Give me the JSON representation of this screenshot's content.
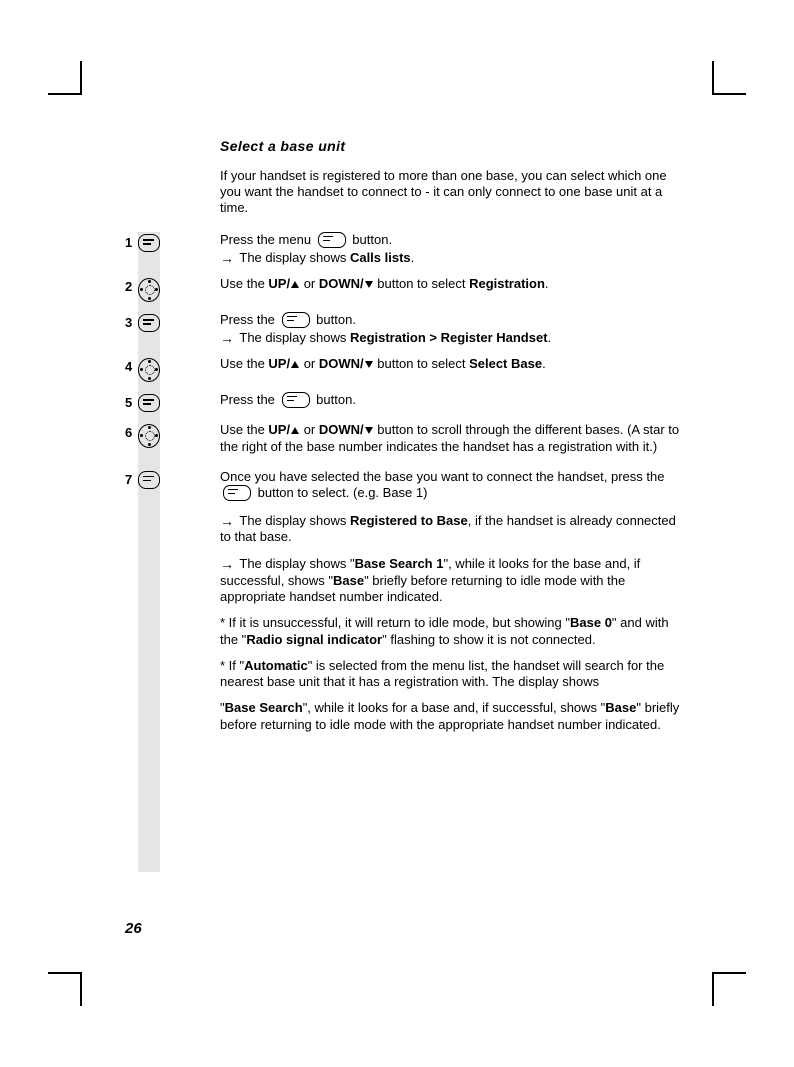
{
  "heading": "Select a base unit",
  "intro": "If your handset is registered to more than one base, you can select which one you want the handset to connect to - it can only connect to one base unit at a time.",
  "steps": {
    "s1": {
      "num": "1",
      "line": "Press the menu",
      "after": " button.",
      "result_pre": "The display shows ",
      "result_b": "Calls lists",
      "result_post": "."
    },
    "s2": {
      "num": "2",
      "pre": "Use the ",
      "up": "UP/",
      "mid": " or ",
      "down": "DOWN/",
      "post": " button to select ",
      "target": "Registration",
      "end": "."
    },
    "s3": {
      "num": "3",
      "line": "Press the",
      "after": " button.",
      "result_pre": "The display shows ",
      "result_b": "Registration > Register Handset",
      "result_post": "."
    },
    "s4": {
      "num": "4",
      "pre": "Use the ",
      "up": "UP/",
      "mid": " or ",
      "down": "DOWN/",
      "post": " button to select ",
      "target": "Select Base",
      "end": "."
    },
    "s5": {
      "num": "5",
      "line": "Press the",
      "after": " button."
    },
    "s6": {
      "num": "6",
      "pre": "Use the ",
      "up": "UP/",
      "mid": " or ",
      "down": "DOWN/",
      "post": " button to scroll through the different bases. (A star to the right of the base number indicates the handset has a registration with it.)"
    },
    "s7": {
      "num": "7",
      "line1": "Once you have selected the base you want to connect the handset, press the ",
      "line1b": " button to select. (e.g. Base 1)"
    }
  },
  "extra": {
    "p1_pre": "The display shows ",
    "p1_b": "Registered to Base",
    "p1_post": ", if the handset is already connected to that base.",
    "p2_pre": "The display shows \"",
    "p2_b1": "Base Search 1",
    "p2_mid": "\", while it looks for the base and, if successful, shows \"",
    "p2_b2": "Base",
    "p2_post": "\" briefly before returning to idle mode with the appropriate handset number indicated.",
    "p3_pre": "* If it is unsuccessful, it will return to idle mode, but showing \"",
    "p3_b1": "Base 0",
    "p3_mid": "\" and with the \"",
    "p3_b2": "Radio signal indicator",
    "p3_post": "\" flashing to show it is not connected.",
    "p4_pre": "* If \"",
    "p4_b": "Automatic",
    "p4_post": "\" is selected from the menu list, the handset will search for the nearest base unit that it has a registration with. The display shows",
    "p5_pre": "\"",
    "p5_b1": "Base Search",
    "p5_mid": "\", while it looks for a base and, if successful, shows \"",
    "p5_b2": "Base",
    "p5_post": "\" briefly before returning to idle mode with the appropriate handset number indicated."
  },
  "page_number": "26"
}
